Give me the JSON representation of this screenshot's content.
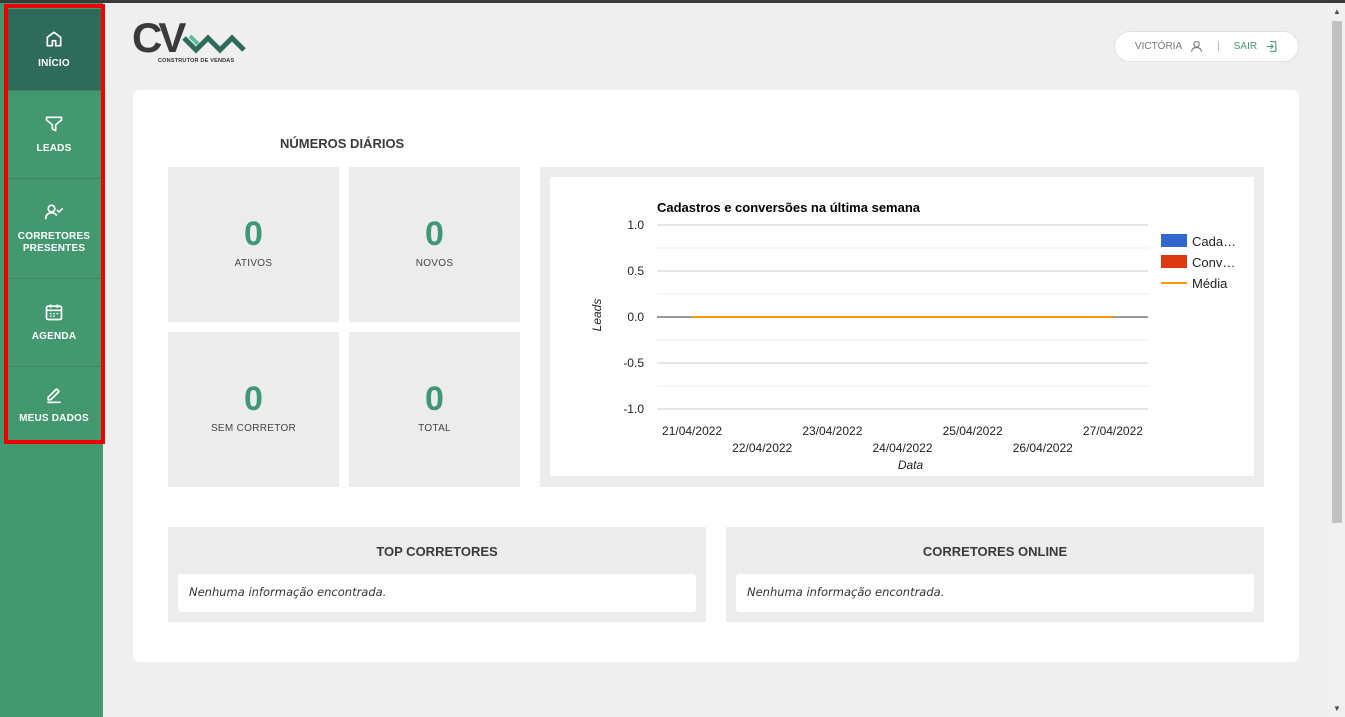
{
  "sidebar": {
    "items": [
      {
        "label_lines": [
          "INÍCIO"
        ],
        "icon": "home-icon",
        "active": true
      },
      {
        "label_lines": [
          "LEADS"
        ],
        "icon": "filter-icon",
        "active": false
      },
      {
        "label_lines": [
          "CORRETORES",
          "PRESENTES"
        ],
        "icon": "user-check-icon",
        "active": false
      },
      {
        "label_lines": [
          "AGENDA"
        ],
        "icon": "calendar-icon",
        "active": false
      },
      {
        "label_lines": [
          "MEUS DADOS"
        ],
        "icon": "edit-icon",
        "active": false
      }
    ]
  },
  "header": {
    "logo_text": "CV",
    "logo_subtitle": "CONSTRUTOR DE VENDAS",
    "user_name": "VICTÓRIA",
    "separator": "|",
    "logout_label": "SAIR"
  },
  "daily": {
    "title": "NÚMEROS DIÁRIOS",
    "stats": [
      {
        "value": "0",
        "label": "ATIVOS"
      },
      {
        "value": "0",
        "label": "NOVOS"
      },
      {
        "value": "0",
        "label": "SEM CORRETOR"
      },
      {
        "value": "0",
        "label": "TOTAL"
      }
    ]
  },
  "chart_data": {
    "type": "line",
    "title": "Cadastros e conversões na última semana",
    "xlabel": "Data",
    "ylabel": "Leads",
    "x": [
      "21/04/2022",
      "22/04/2022",
      "23/04/2022",
      "24/04/2022",
      "25/04/2022",
      "26/04/2022",
      "27/04/2022"
    ],
    "yticks": [
      "1.0",
      "0.5",
      "0.0",
      "-0.5",
      "-1.0"
    ],
    "ylim": [
      -1.0,
      1.0
    ],
    "grid": true,
    "legend_position": "right",
    "series": [
      {
        "name": "Cada…",
        "type": "bar",
        "color": "#3366cc",
        "values": [
          0,
          0,
          0,
          0,
          0,
          0,
          0
        ]
      },
      {
        "name": "Conv…",
        "type": "bar",
        "color": "#dc3912",
        "values": [
          0,
          0,
          0,
          0,
          0,
          0,
          0
        ]
      },
      {
        "name": "Média",
        "type": "line",
        "color": "#ff9900",
        "values": [
          0,
          0,
          0,
          0,
          0,
          0,
          0
        ]
      }
    ]
  },
  "top_corretores": {
    "title": "TOP CORRETORES",
    "message": "Nenhuma informação encontrada."
  },
  "corretores_online": {
    "title": "CORRETORES ONLINE",
    "message": "Nenhuma informação encontrada."
  }
}
